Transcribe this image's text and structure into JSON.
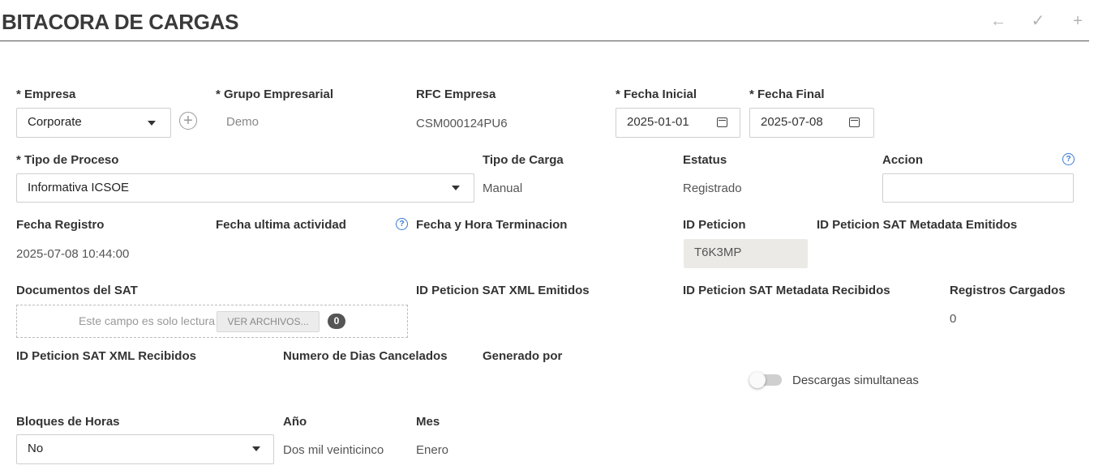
{
  "page": {
    "title": "BITACORA DE CARGAS"
  },
  "toolbar": {
    "back_icon": "arrow-left-icon",
    "confirm_icon": "check-icon",
    "add_icon": "plus-icon"
  },
  "form": {
    "empresa": {
      "label": "* Empresa",
      "value": "Corporate"
    },
    "grupo": {
      "label": "* Grupo Empresarial",
      "value": "Demo"
    },
    "rfc": {
      "label": "RFC Empresa",
      "value": "CSM000124PU6"
    },
    "fecha_inicial": {
      "label": "* Fecha Inicial",
      "value": "2025-01-01"
    },
    "fecha_final": {
      "label": "* Fecha Final",
      "value": "2025-07-08"
    },
    "tipo_proceso": {
      "label": "* Tipo de Proceso",
      "value": "Informativa ICSOE"
    },
    "tipo_carga": {
      "label": "Tipo de Carga",
      "value": "Manual"
    },
    "estatus": {
      "label": "Estatus",
      "value": "Registrado"
    },
    "accion": {
      "label": "Accion",
      "value": ""
    },
    "fecha_registro": {
      "label": "Fecha Registro",
      "value": "2025-07-08 10:44:00"
    },
    "fecha_ultima": {
      "label": "Fecha ultima actividad",
      "value": ""
    },
    "fecha_terminacion": {
      "label": "Fecha y Hora Terminacion",
      "value": ""
    },
    "id_peticion": {
      "label": "ID Peticion",
      "value": "T6K3MP"
    },
    "id_meta_emitidos": {
      "label": "ID Peticion SAT Metadata Emitidos",
      "value": ""
    },
    "documentos": {
      "label": "Documentos del SAT",
      "readonly_text": "Este campo es solo lectura",
      "button_label": "VER ARCHIVOS...",
      "count": "0"
    },
    "id_xml_emitidos": {
      "label": "ID Peticion SAT XML Emitidos",
      "value": ""
    },
    "id_meta_recibidos": {
      "label": "ID Peticion SAT Metadata Recibidos",
      "value": ""
    },
    "registros": {
      "label": "Registros Cargados",
      "value": "0"
    },
    "id_xml_recibidos": {
      "label": "ID Peticion SAT XML Recibidos",
      "value": ""
    },
    "dias_cancelados": {
      "label": "Numero de Dias Cancelados",
      "value": ""
    },
    "generado_por": {
      "label": "Generado por",
      "value": ""
    },
    "descargas": {
      "label": "Descargas simultaneas",
      "enabled": false
    },
    "bloques": {
      "label": "Bloques de Horas",
      "value": "No"
    },
    "anio": {
      "label": "Año",
      "value": "Dos mil veinticinco"
    },
    "mes": {
      "label": "Mes",
      "value": "Enero"
    }
  },
  "colors": {
    "accent": "#3a7bd5",
    "readonly_bg": "#eceae6",
    "badge_bg": "#555555"
  }
}
